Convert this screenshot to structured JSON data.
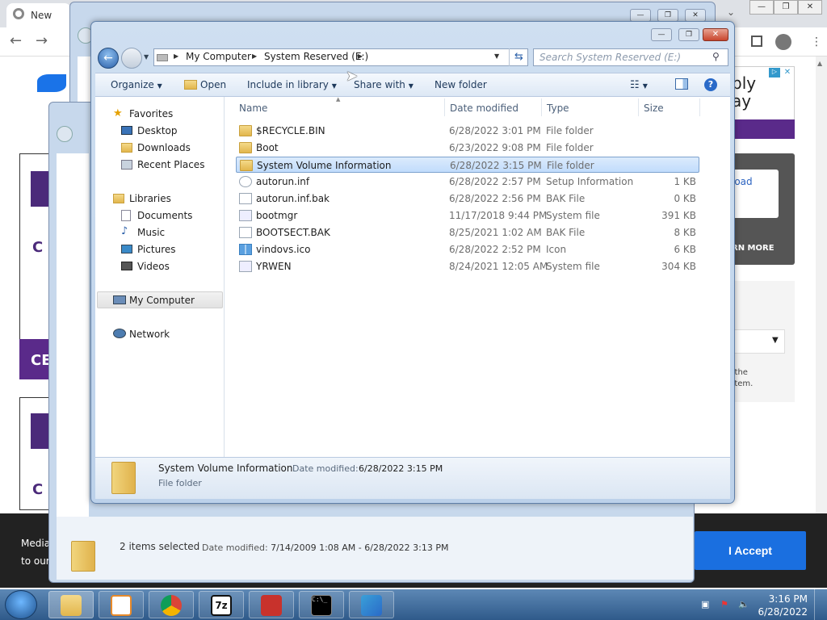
{
  "browser": {
    "tab_label": "New",
    "cookie_text_1": "Media",
    "cookie_text_2": "to our",
    "accept_label": "I Accept",
    "ad_text_1": "ply",
    "ad_text_2": "ay",
    "card_link": "load",
    "card_more": "RN MORE",
    "side_text_1": "h the",
    "side_text_2": "rstem.",
    "left_letters_1": "C",
    "left_letters_2": "CE",
    "left_letters_3": "C"
  },
  "back_window": {
    "status": "2 items selected",
    "date_label": "Date modified:",
    "date_value": "7/14/2009 1:08 AM - 6/28/2022 3:13 PM"
  },
  "explorer": {
    "breadcrumb": [
      "My Computer",
      "System Reserved (E:)"
    ],
    "search_placeholder": "Search System Reserved (E:)",
    "toolbar": {
      "organize": "Organize",
      "open": "Open",
      "include_in_library": "Include in library",
      "share_with": "Share with",
      "new_folder": "New folder"
    },
    "nav": {
      "favorites": "Favorites",
      "desktop": "Desktop",
      "downloads": "Downloads",
      "recent_places": "Recent Places",
      "libraries": "Libraries",
      "documents": "Documents",
      "music": "Music",
      "pictures": "Pictures",
      "videos": "Videos",
      "my_computer": "My Computer",
      "network": "Network"
    },
    "columns": {
      "name": "Name",
      "date": "Date modified",
      "type": "Type",
      "size": "Size"
    },
    "files": [
      {
        "name": "$RECYCLE.BIN",
        "date": "6/28/2022 3:01 PM",
        "type": "File folder",
        "size": "",
        "icon": "folder-icon"
      },
      {
        "name": "Boot",
        "date": "6/23/2022 9:08 PM",
        "type": "File folder",
        "size": "",
        "icon": "folder-icon"
      },
      {
        "name": "System Volume Information",
        "date": "6/28/2022 3:15 PM",
        "type": "File folder",
        "size": "",
        "icon": "folder-icon"
      },
      {
        "name": "autorun.inf",
        "date": "6/28/2022 2:57 PM",
        "type": "Setup Information",
        "size": "1 KB",
        "icon": "settings-file-icon"
      },
      {
        "name": "autorun.inf.bak",
        "date": "6/28/2022 2:56 PM",
        "type": "BAK File",
        "size": "0 KB",
        "icon": "file-icon"
      },
      {
        "name": "bootmgr",
        "date": "11/17/2018 9:44 PM",
        "type": "System file",
        "size": "391 KB",
        "icon": "system-file-icon"
      },
      {
        "name": "BOOTSECT.BAK",
        "date": "8/25/2021 1:02 AM",
        "type": "BAK File",
        "size": "8 KB",
        "icon": "file-icon"
      },
      {
        "name": "vindovs.ico",
        "date": "6/28/2022 2:52 PM",
        "type": "Icon",
        "size": "6 KB",
        "icon": "windows-logo-icon"
      },
      {
        "name": "YRWEN",
        "date": "8/24/2021 12:05 AM",
        "type": "System file",
        "size": "304 KB",
        "icon": "system-file-icon"
      }
    ],
    "details": {
      "name": "System Volume Information",
      "date_label": "Date modified:",
      "date_value": "6/28/2022 3:15 PM",
      "type": "File folder"
    }
  },
  "taskbar": {
    "time": "3:16 PM",
    "date": "6/28/2022"
  }
}
